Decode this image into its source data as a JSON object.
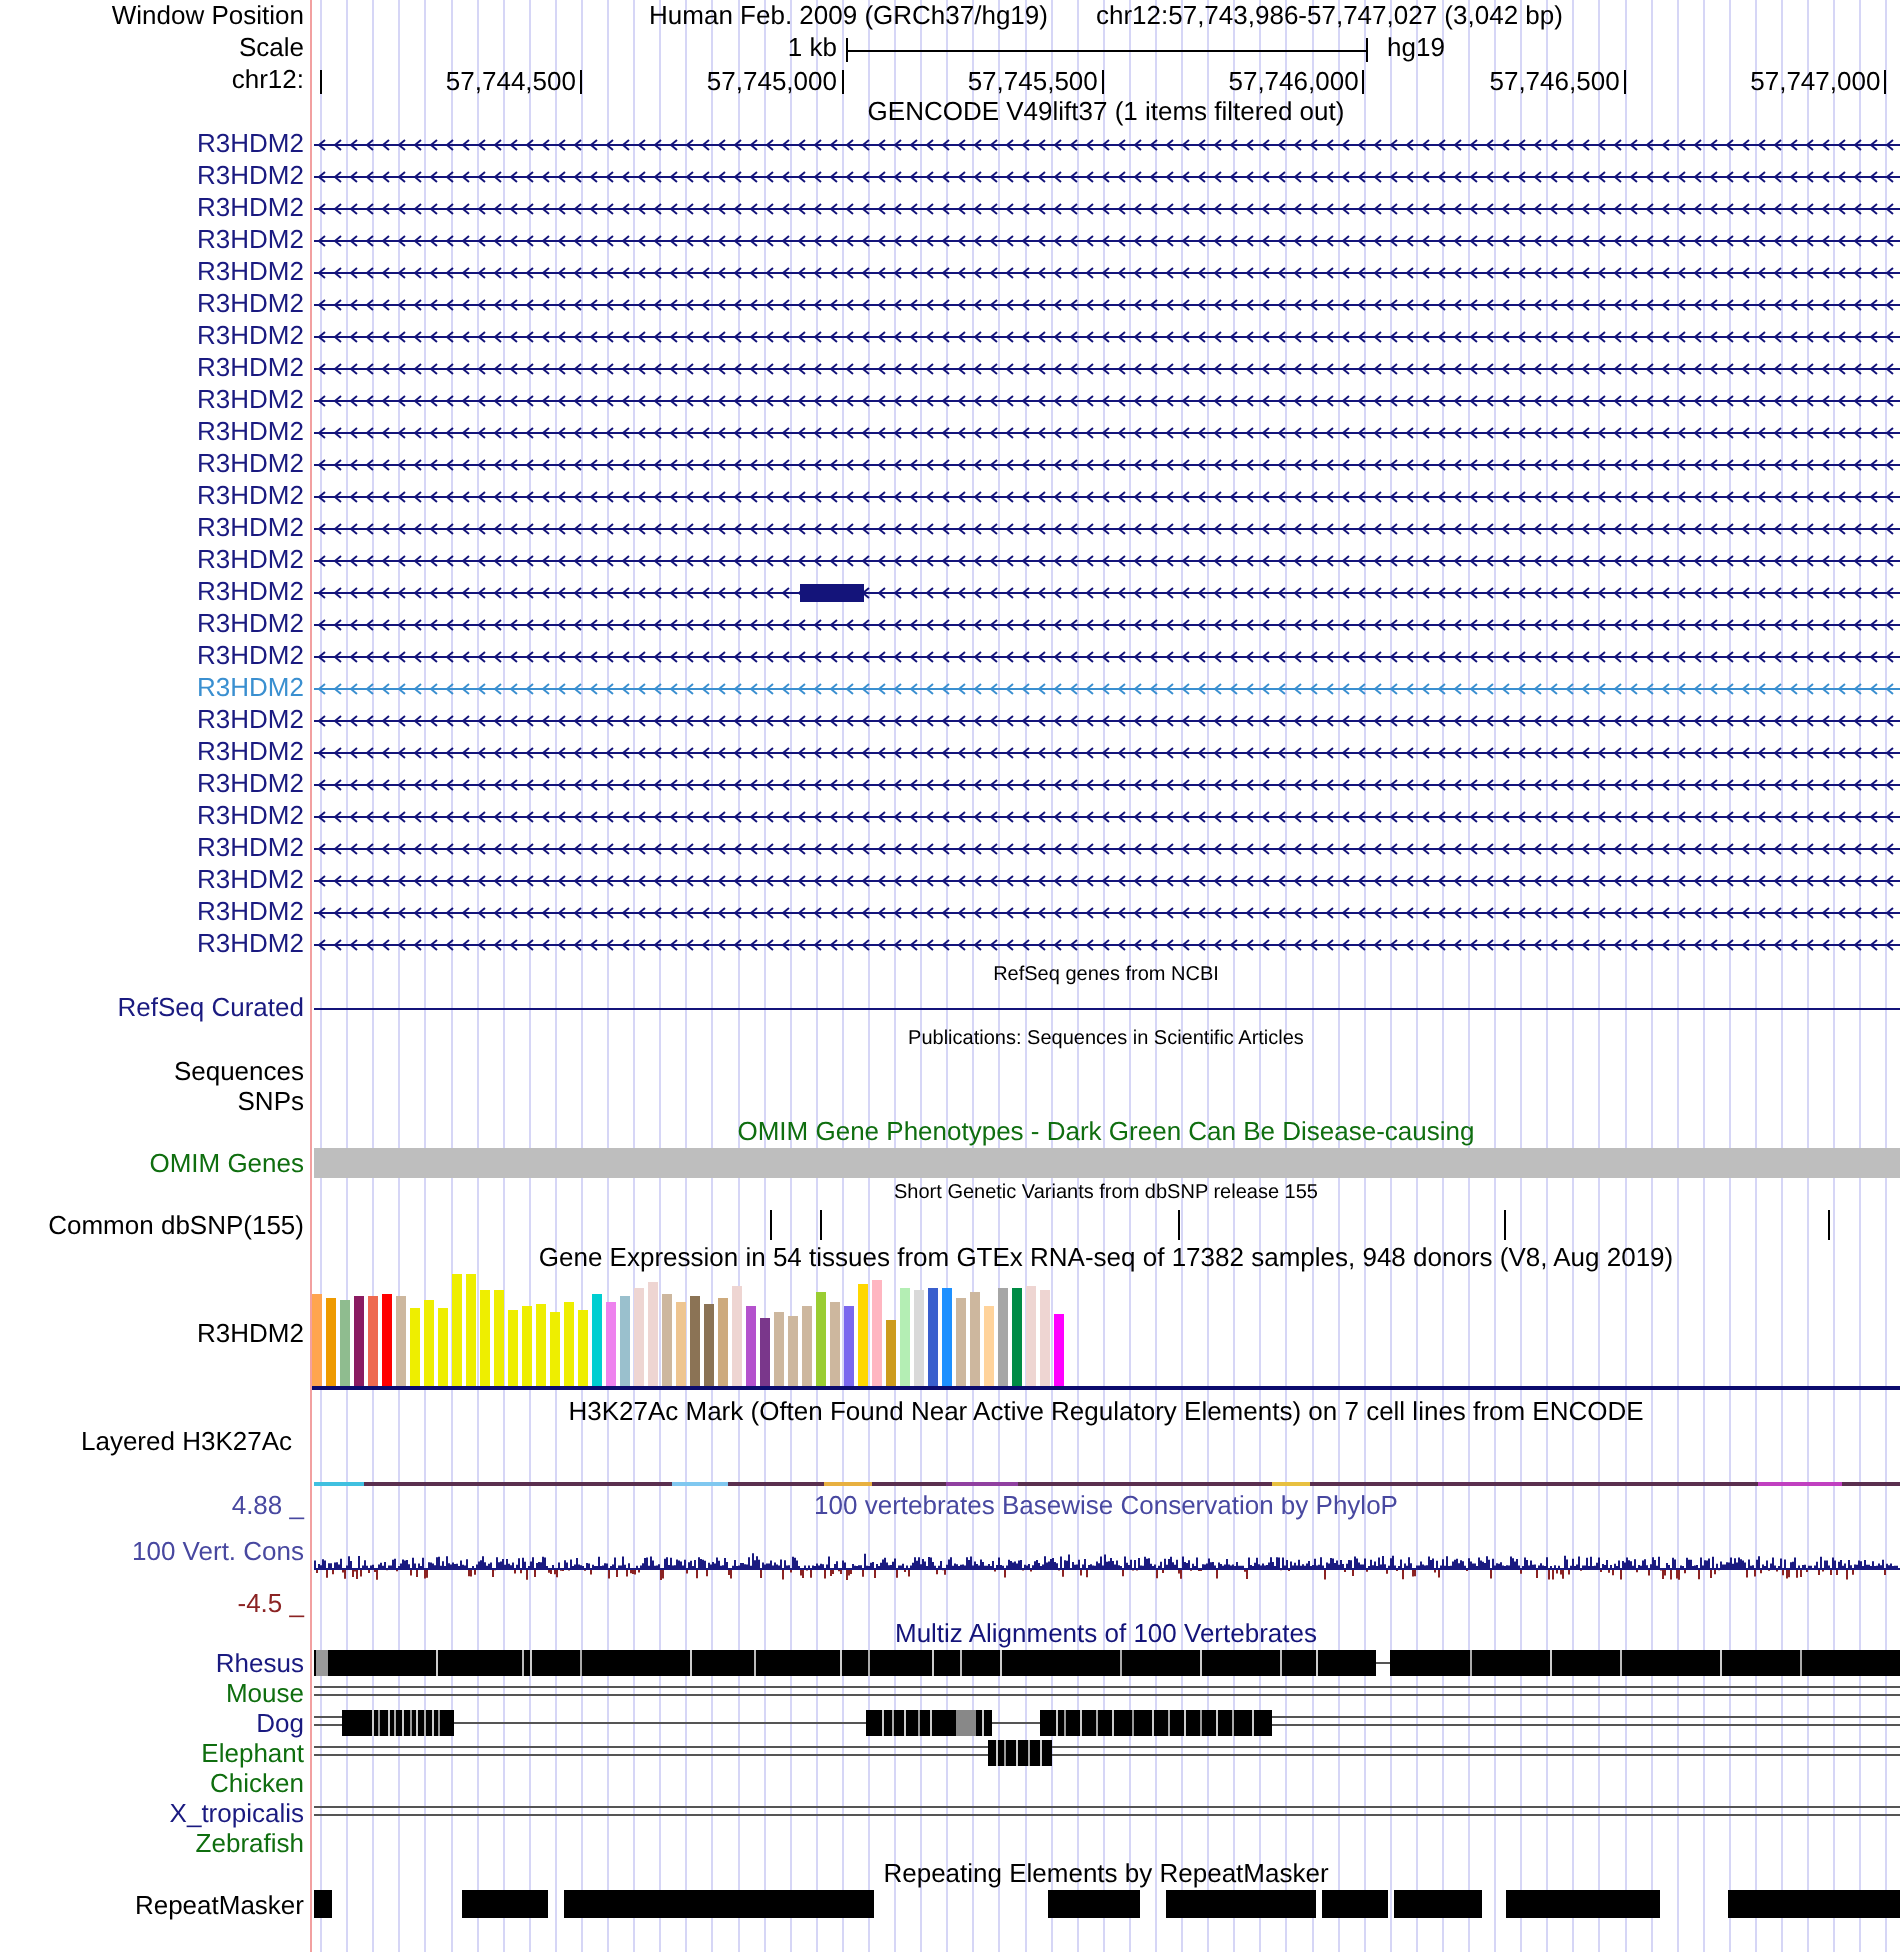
{
  "position_row": {
    "label": "Window Position",
    "assembly": "Human Feb. 2009 (GRCh37/hg19)",
    "range": "chr12:57,743,986-57,747,027 (3,042 bp)"
  },
  "scale_row": {
    "label": "Scale",
    "length": "1 kb",
    "assembly": "hg19"
  },
  "ruler": {
    "label": "chr12:",
    "ticks": [
      "57,744,500",
      "57,745,000",
      "57,745,500",
      "57,746,000",
      "57,746,500",
      "57,747,000"
    ]
  },
  "tracks": [
    {
      "kind": "gencode",
      "title": "GENCODE V49lift37 (1 items filtered out)",
      "items": [
        {
          "label": "R3HDM2",
          "kind": "intron",
          "highlighted": false
        },
        {
          "label": "R3HDM2",
          "kind": "intron",
          "highlighted": false
        },
        {
          "label": "R3HDM2",
          "kind": "intron",
          "highlighted": false
        },
        {
          "label": "R3HDM2",
          "kind": "intron",
          "highlighted": false
        },
        {
          "label": "R3HDM2",
          "kind": "intron",
          "highlighted": false
        },
        {
          "label": "R3HDM2",
          "kind": "intron",
          "highlighted": false
        },
        {
          "label": "R3HDM2",
          "kind": "intron",
          "highlighted": false
        },
        {
          "label": "R3HDM2",
          "kind": "intron",
          "highlighted": false
        },
        {
          "label": "R3HDM2",
          "kind": "intron",
          "highlighted": false
        },
        {
          "label": "R3HDM2",
          "kind": "intron",
          "highlighted": false
        },
        {
          "label": "R3HDM2",
          "kind": "intron",
          "highlighted": false
        },
        {
          "label": "R3HDM2",
          "kind": "intron",
          "highlighted": false
        },
        {
          "label": "R3HDM2",
          "kind": "intron",
          "highlighted": false
        },
        {
          "label": "R3HDM2",
          "kind": "intron",
          "highlighted": false
        },
        {
          "label": "R3HDM2",
          "kind": "exon",
          "highlighted": false
        },
        {
          "label": "R3HDM2",
          "kind": "intron",
          "highlighted": false
        },
        {
          "label": "R3HDM2",
          "kind": "intron",
          "highlighted": false
        },
        {
          "label": "R3HDM2",
          "kind": "intron",
          "highlighted": true
        },
        {
          "label": "R3HDM2",
          "kind": "intron",
          "highlighted": false
        },
        {
          "label": "R3HDM2",
          "kind": "intron",
          "highlighted": false
        },
        {
          "label": "R3HDM2",
          "kind": "intron",
          "highlighted": false
        },
        {
          "label": "R3HDM2",
          "kind": "intron",
          "highlighted": false
        },
        {
          "label": "R3HDM2",
          "kind": "intron",
          "highlighted": false
        },
        {
          "label": "R3HDM2",
          "kind": "intron",
          "highlighted": false
        },
        {
          "label": "R3HDM2",
          "kind": "intron",
          "highlighted": false
        },
        {
          "label": "R3HDM2",
          "kind": "intron",
          "highlighted": false
        }
      ]
    },
    {
      "kind": "refseq",
      "title": "RefSeq genes from NCBI",
      "label": "RefSeq Curated"
    },
    {
      "kind": "publications",
      "title": "Publications: Sequences in Scientific Articles",
      "subtracks": [
        {
          "label": "Sequences"
        },
        {
          "label": "SNPs"
        }
      ]
    },
    {
      "kind": "omim",
      "title": "OMIM Gene Phenotypes - Dark Green Can Be Disease-causing",
      "label": "OMIM Genes"
    },
    {
      "kind": "snp",
      "title": "Short Genetic Variants from dbSNP release 155",
      "label": "Common dbSNP(155)"
    },
    {
      "kind": "gtex",
      "title": "Gene Expression in 54 tissues from GTEx RNA-seq of 17382 samples, 948 donors (V8, Aug 2019)",
      "label": "R3HDM2"
    },
    {
      "kind": "signal",
      "title": "H3K27Ac Mark (Often Found Near Active Regulatory Elements) on 7 cell lines from ENCODE",
      "label": "Layered H3K27Ac"
    },
    {
      "kind": "wiggle",
      "title": "100 vertebrates Basewise Conservation by PhyloP",
      "label": "100 Vert. Cons",
      "max_label": "4.88 _",
      "min_label": "-4.5 _"
    },
    {
      "kind": "multiz",
      "title": "Multiz Alignments of 100 Vertebrates",
      "species": [
        {
          "name": "Rhesus",
          "color": "#1a1a80"
        },
        {
          "name": "Mouse",
          "color": "#0f6e0f"
        },
        {
          "name": "Dog",
          "color": "#1a1a80"
        },
        {
          "name": "Elephant",
          "color": "#0f6e0f"
        },
        {
          "name": "Chicken",
          "color": "#0f6e0f"
        },
        {
          "name": "X_tropicalis",
          "color": "#1a1a80"
        },
        {
          "name": "Zebrafish",
          "color": "#0f6e0f"
        }
      ]
    },
    {
      "kind": "repeats",
      "title": "Repeating Elements by RepeatMasker",
      "label": "RepeatMasker"
    }
  ]
}
